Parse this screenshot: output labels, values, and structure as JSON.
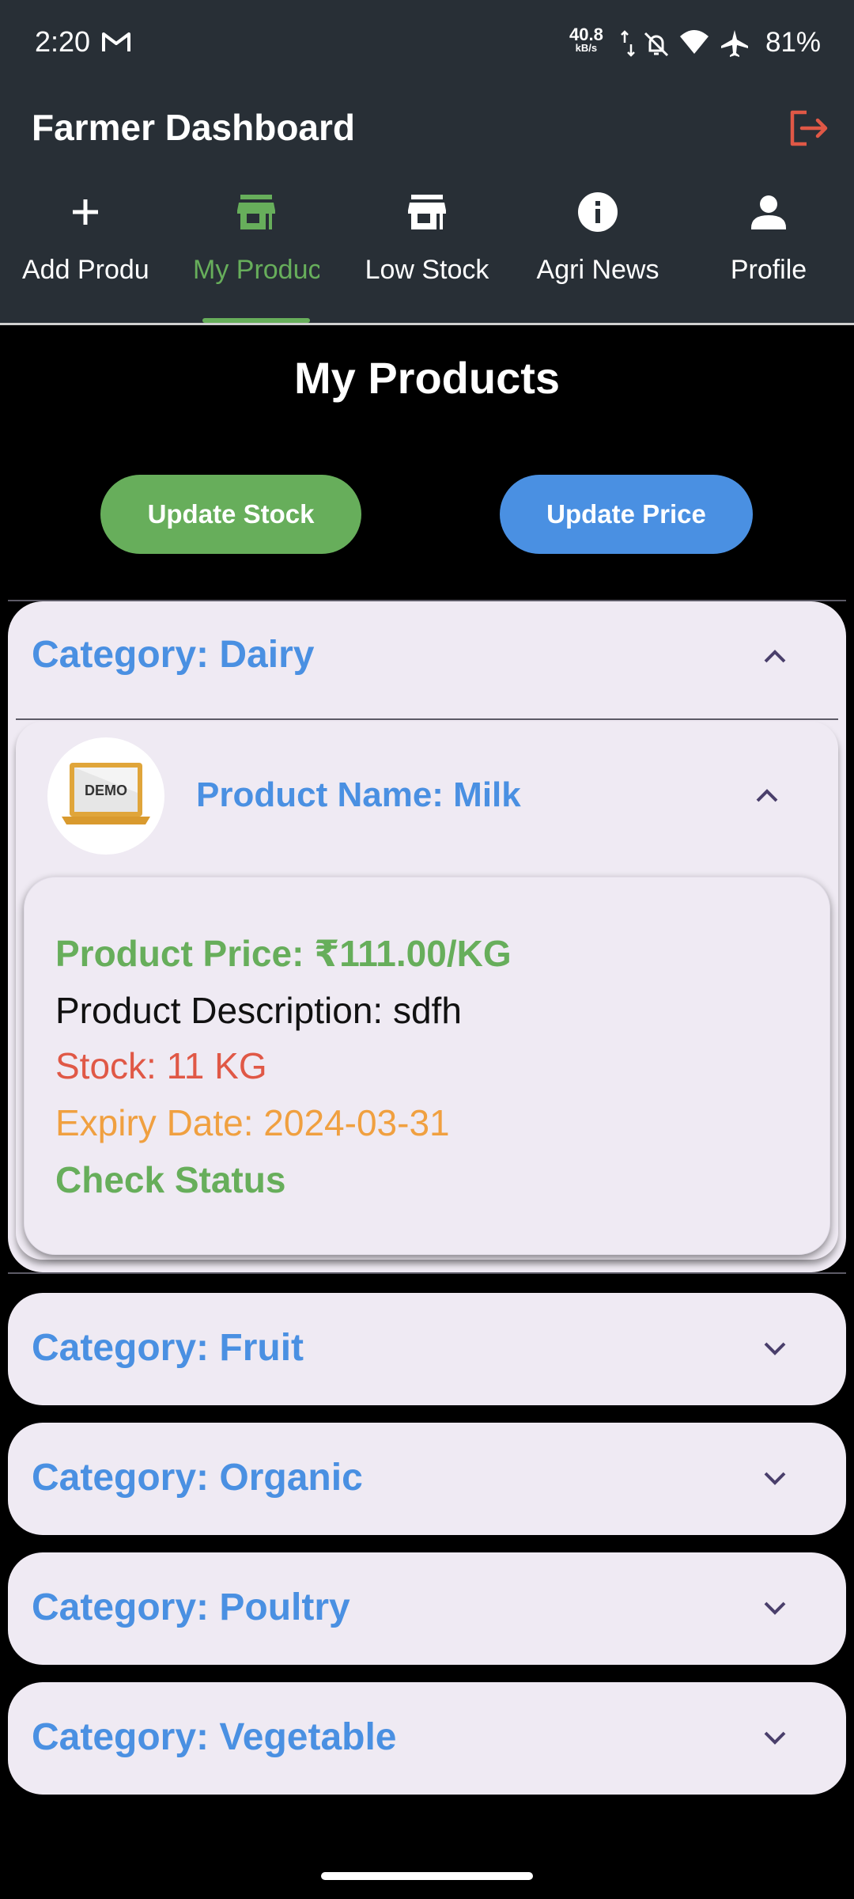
{
  "status_bar": {
    "time": "2:20",
    "net_speed": "40.8",
    "net_unit": "kB/s",
    "battery": "81%"
  },
  "app_bar": {
    "title": "Farmer Dashboard",
    "logout_icon": "logout-icon",
    "accent_color": "#e05846"
  },
  "tabs": [
    {
      "label": "Add Product",
      "icon": "plus-icon",
      "active": false
    },
    {
      "label": "My Products",
      "icon": "store-icon",
      "active": true
    },
    {
      "label": "Low Stock",
      "icon": "store-icon",
      "active": false
    },
    {
      "label": "Agri News",
      "icon": "info-icon",
      "active": false
    },
    {
      "label": "Profile",
      "icon": "person-icon",
      "active": false
    }
  ],
  "main": {
    "title": "My Products",
    "update_stock_label": "Update Stock",
    "update_price_label": "Update Price"
  },
  "categories": [
    {
      "title": "Category: Dairy",
      "expanded": true,
      "product": {
        "name": "Product Name: Milk",
        "image_label": "DEMO",
        "price": "Product Price: ₹111.00/KG",
        "description": "Product Description: sdfh",
        "stock": "Stock: 11 KG",
        "expiry": "Expiry Date: 2024-03-31",
        "status": "Check Status"
      }
    },
    {
      "title": "Category: Fruit",
      "expanded": false
    },
    {
      "title": "Category: Organic",
      "expanded": false
    },
    {
      "title": "Category: Poultry",
      "expanded": false
    },
    {
      "title": "Category: Vegetable",
      "expanded": false
    }
  ],
  "colors": {
    "green": "#67ae5b",
    "blue": "#4a90e2",
    "red": "#e05846",
    "orange": "#f0a040",
    "card_bg": "#efeaf3",
    "app_bar_bg": "#282f36"
  }
}
